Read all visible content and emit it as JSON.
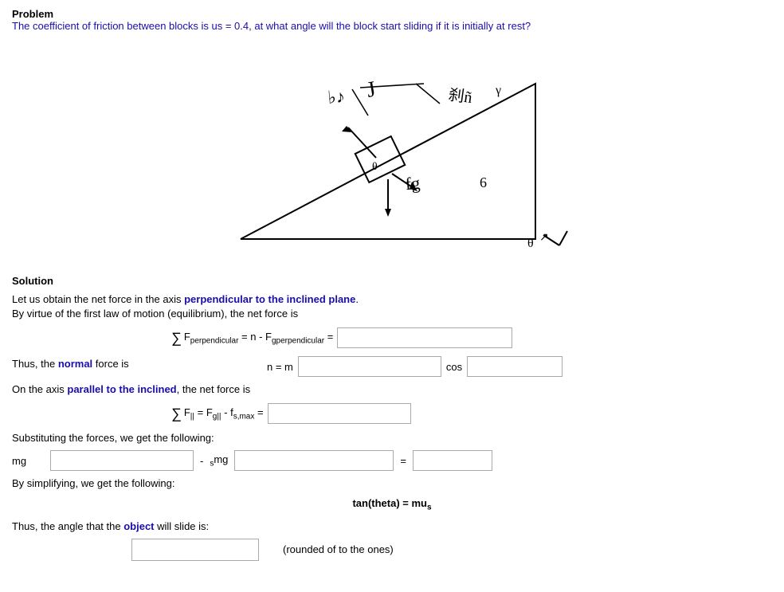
{
  "problem": {
    "title": "Problem",
    "text": "The coefficient of friction between blocks is us = 0.4, at what angle will the block start sliding if it is initially at rest?"
  },
  "solution": {
    "title": "Solution",
    "line1": "Let us obtain the net force in the axis ",
    "line1_highlight": "perpendicular to the inclined plane",
    "line1_end": ".",
    "line2": "By virtue of the first law of motion (equilibrium), the net force is",
    "eq1_left": "∑ F",
    "eq1_sub": "perpendicular",
    "eq1_mid": " = n - F",
    "eq1_sub2": "gperpendicular",
    "eq1_eq": "=",
    "normal_label": "Thus, the ",
    "normal_highlight": "normal",
    "normal_end": " force is",
    "n_eq": "n = m",
    "cos_label": "cos",
    "parallel_label": "On the axis ",
    "parallel_highlight": "parallel to the inclined",
    "parallel_end": ", the net force is",
    "eq2_left": "∑ F",
    "eq2_sub": "||",
    "eq2_mid": " = F",
    "eq2_sub2": "g||",
    "eq2_mid2": " - f",
    "eq2_sub3": "s,max",
    "eq2_eq": "=",
    "subst_label": "Substituting the forces, we get the following:",
    "mg_left": "mg",
    "mg_dash": "-",
    "mg_sub": "s",
    "mg_right": "mg",
    "mg_eq": "=",
    "simplify_label": "By simplifying, we get the following:",
    "tan_eq": "tan(theta) = mu",
    "tan_sub": "s",
    "angle_label": "Thus, the angle that the object will slide is:",
    "rounded_label": "(rounded of to the ones)"
  }
}
